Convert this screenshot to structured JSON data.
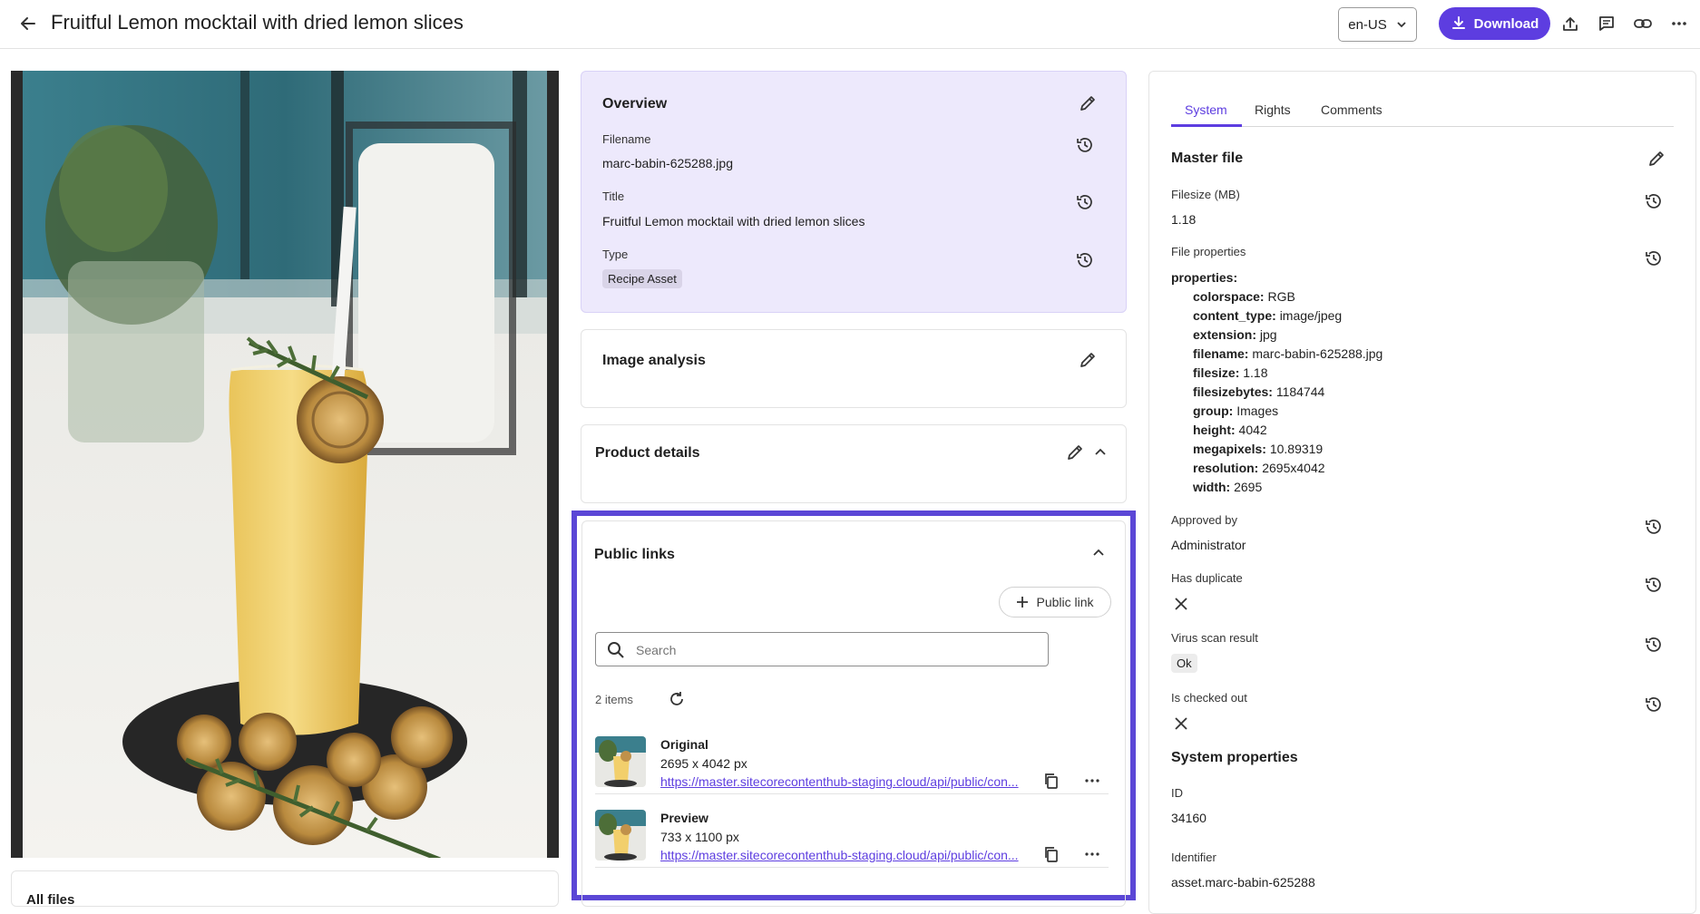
{
  "header": {
    "title": "Fruitful Lemon mocktail with dried lemon slices",
    "locale": "en-US",
    "download_label": "Download"
  },
  "icons": {
    "back": "arrow-left-icon",
    "upload": "upload-icon",
    "comment": "comment-icon",
    "link": "link-icon",
    "more": "more-horizontal-icon",
    "edit": "pencil-icon",
    "history": "history-icon",
    "chevron_up": "chevron-up-icon",
    "plus": "plus-icon",
    "search": "search-icon",
    "refresh": "refresh-icon",
    "copy": "copy-icon",
    "close": "x-icon"
  },
  "colors": {
    "accent": "#5d3de0",
    "overview_bg": "#ede9fc",
    "highlight_border": "#5b47d6"
  },
  "all_files_label": "All files",
  "overview": {
    "title": "Overview",
    "filename_label": "Filename",
    "filename": "marc-babin-625288.jpg",
    "title_label": "Title",
    "title_value": "Fruitful Lemon mocktail with dried lemon slices",
    "type_label": "Type",
    "type_value": "Recipe Asset"
  },
  "image_analysis": {
    "title": "Image analysis"
  },
  "product_details": {
    "title": "Product details"
  },
  "public_links": {
    "title": "Public links",
    "add_button": "Public link",
    "search_placeholder": "Search",
    "items_count": "2 items",
    "items": [
      {
        "name": "Original",
        "dimensions": "2695 x 4042 px",
        "url": "https://master.sitecorecontenthub-staging.cloud/api/public/con..."
      },
      {
        "name": "Preview",
        "dimensions": "733 x 1100 px",
        "url": "https://master.sitecorecontenthub-staging.cloud/api/public/con..."
      }
    ]
  },
  "side_panel": {
    "tabs": [
      "System",
      "Rights",
      "Comments"
    ],
    "active_tab": "System",
    "master_file": {
      "title": "Master file",
      "filesize_label": "Filesize (MB)",
      "filesize": "1.18",
      "file_props_label": "File properties",
      "properties_heading": "properties:",
      "properties": [
        {
          "key": "colorspace:",
          "value": "RGB"
        },
        {
          "key": "content_type:",
          "value": "image/jpeg"
        },
        {
          "key": "extension:",
          "value": "jpg"
        },
        {
          "key": "filename:",
          "value": "marc-babin-625288.jpg"
        },
        {
          "key": "filesize:",
          "value": "1.18"
        },
        {
          "key": "filesizebytes:",
          "value": "1184744"
        },
        {
          "key": "group:",
          "value": "Images"
        },
        {
          "key": "height:",
          "value": "4042"
        },
        {
          "key": "megapixels:",
          "value": "10.89319"
        },
        {
          "key": "resolution:",
          "value": "2695x4042"
        },
        {
          "key": "width:",
          "value": "2695"
        }
      ],
      "approved_label": "Approved by",
      "approved_value": "Administrator",
      "duplicate_label": "Has duplicate",
      "virus_label": "Virus scan result",
      "virus_value": "Ok",
      "checked_out_label": "Is checked out"
    },
    "system_properties": {
      "title": "System properties",
      "id_label": "ID",
      "id_value": "34160",
      "identifier_label": "Identifier",
      "identifier_value": "asset.marc-babin-625288"
    }
  }
}
